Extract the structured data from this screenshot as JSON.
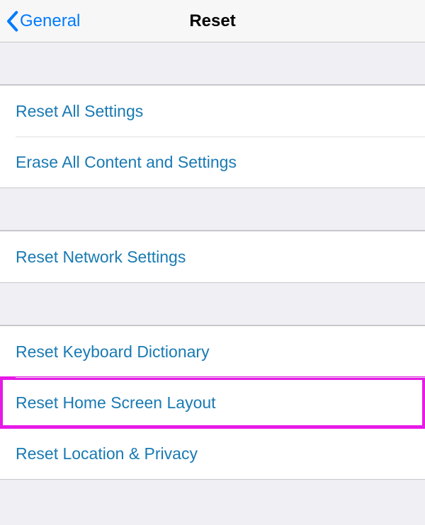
{
  "header": {
    "back_label": "General",
    "title": "Reset"
  },
  "group1": {
    "items": [
      {
        "label": "Reset All Settings"
      },
      {
        "label": "Erase All Content and Settings"
      }
    ]
  },
  "group2": {
    "items": [
      {
        "label": "Reset Network Settings"
      }
    ]
  },
  "group3": {
    "items": [
      {
        "label": "Reset Keyboard Dictionary"
      },
      {
        "label": "Reset Home Screen Layout"
      },
      {
        "label": "Reset Location & Privacy"
      }
    ]
  }
}
